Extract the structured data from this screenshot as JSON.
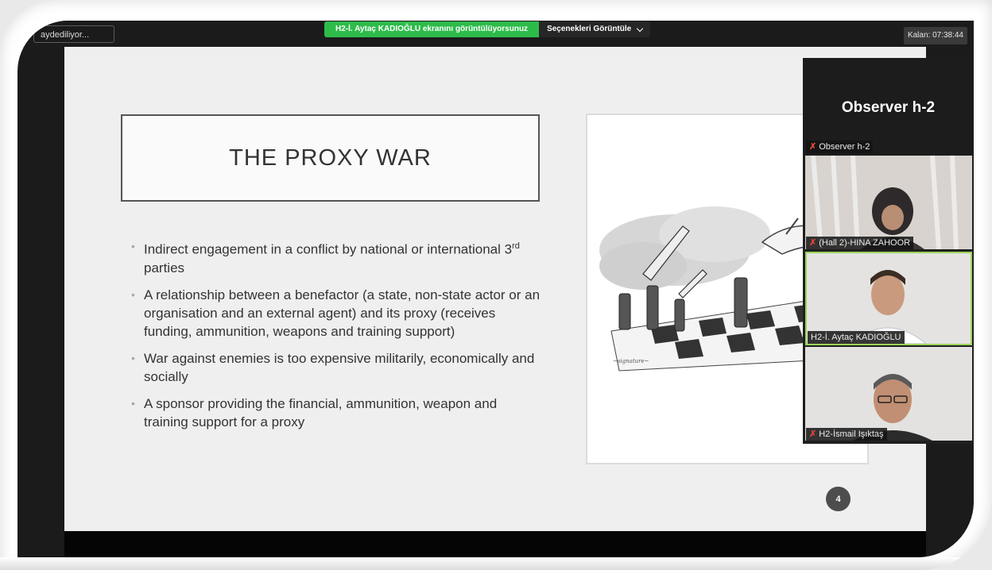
{
  "top_bar": {
    "recording_label": "aydediliyor...",
    "share_banner": "H2-İ. Aytaç KADIOĞLU ekranını görüntülüyorsunuz",
    "view_options": "Seçenekleri Görüntüle",
    "remaining_time": "Kalan: 07:38:44"
  },
  "slide": {
    "title": "THE PROXY WAR",
    "bullets": [
      {
        "text": "Indirect engagement in a conflict by national or international 3",
        "sup": "rd",
        "tail": " parties"
      },
      {
        "text": "A relationship between a benefactor (a state, non-state actor or an organisation and an external agent) and its proxy (receives funding, ammunition, weapons and training support)"
      },
      {
        "text": "War against enemies is too expensive militarily, economically and socially"
      },
      {
        "text": "A sponsor providing the financial, ammunition, weapon and training support for a proxy"
      }
    ],
    "page_number": "4"
  },
  "participants": {
    "active_speaker_large": "Observer h-2",
    "tiles": [
      {
        "name": "Observer h-2",
        "muted": true
      },
      {
        "name": "(Hall 2)-HINA ZAHOOR",
        "muted": true
      },
      {
        "name": "H2-İ. Aytaç KADIOĞLU",
        "muted": false
      },
      {
        "name": "H2-İsmail Işıktaş",
        "muted": true
      }
    ]
  },
  "colors": {
    "share_green": "#2dbb4a",
    "active_border": "#9bd35a",
    "muted_red": "#e0433a"
  }
}
